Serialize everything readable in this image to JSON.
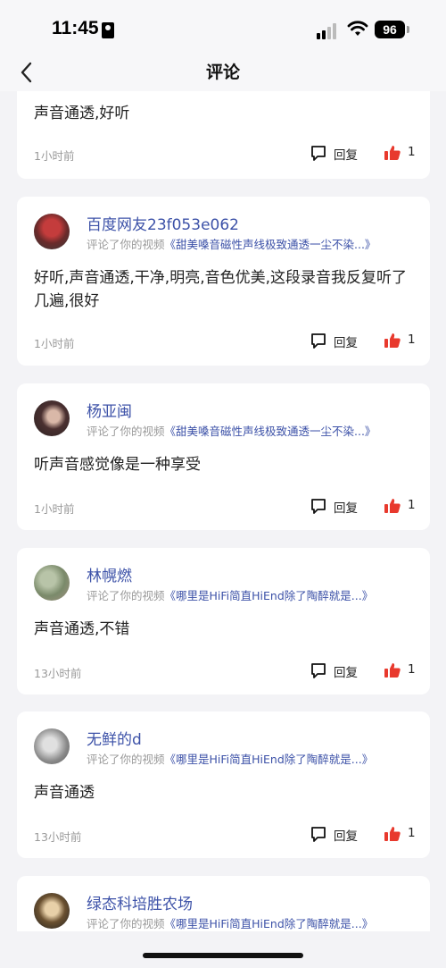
{
  "status_bar": {
    "time": "11:45",
    "battery": "96"
  },
  "nav": {
    "title": "评论"
  },
  "labels": {
    "reply": "回复"
  },
  "colors": {
    "link": "#3d52a8",
    "like": "#e8392d",
    "background": "#f3f3f6"
  },
  "comments": [
    {
      "comment": "声音通透,好听",
      "time": "1小时前",
      "likes": "1"
    },
    {
      "username": "百度网友23f053e062",
      "action": "评论了你的视频",
      "video": "《甜美嗓音磁性声线极致通透一尘不染...》",
      "comment": "好听,声音通透,干净,明亮,音色优美,这段录音我反复听了几遍,很好",
      "time": "1小时前",
      "likes": "1"
    },
    {
      "username": "杨亚闽",
      "action": "评论了你的视频",
      "video": "《甜美嗓音磁性声线极致通透一尘不染...》",
      "comment": "听声音感觉像是一种享受",
      "time": "1小时前",
      "likes": "1"
    },
    {
      "username": "林幌燃",
      "action": "评论了你的视频",
      "video": "《哪里是HiFi简直HiEnd除了陶醉就是...》",
      "comment": "声音通透,不错",
      "time": "13小时前",
      "likes": "1"
    },
    {
      "username": "无鲜的d",
      "action": "评论了你的视频",
      "video": "《哪里是HiFi简直HiEnd除了陶醉就是...》",
      "comment": "声音通透",
      "time": "13小时前",
      "likes": "1"
    },
    {
      "username": "绿态科培胜农场",
      "action": "评论了你的视频",
      "video": "《哪里是HiFi简直HiEnd除了陶醉就是...》"
    }
  ]
}
